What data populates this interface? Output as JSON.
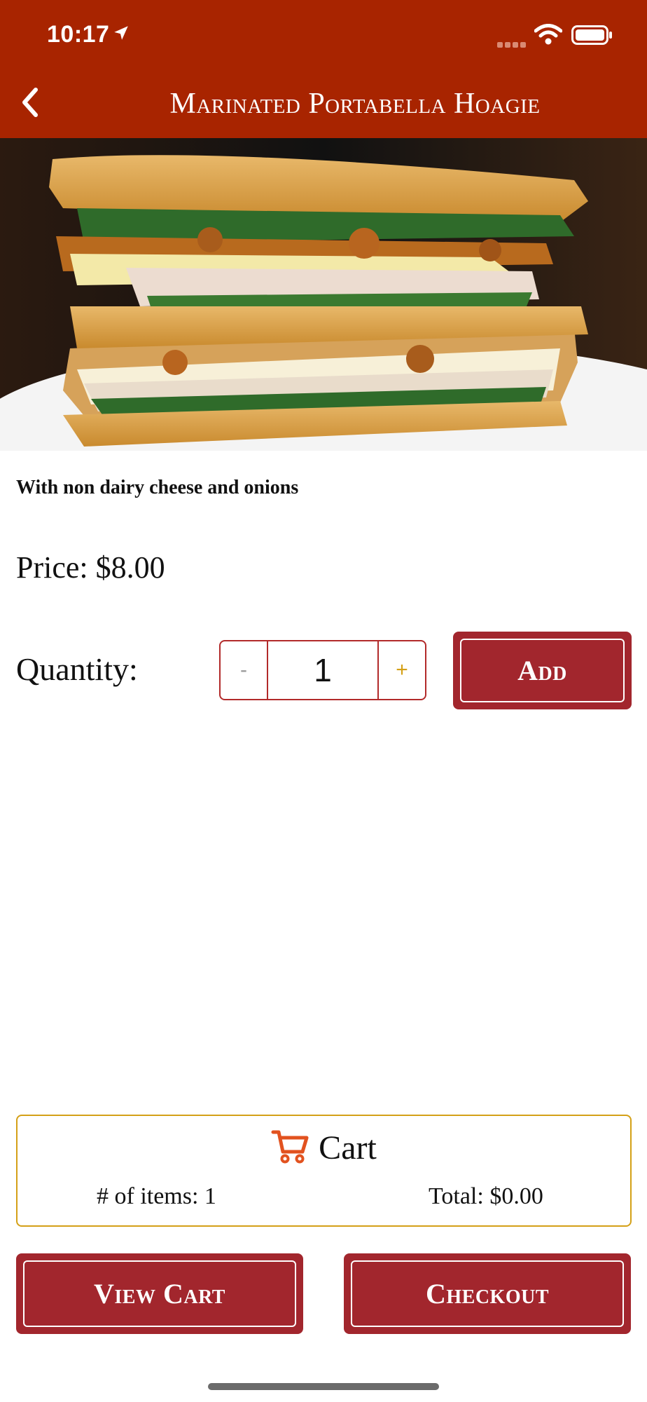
{
  "status_bar": {
    "time": "10:17",
    "icons": [
      "location-arrow-icon",
      "cellular-signal-icon",
      "wifi-icon",
      "battery-icon"
    ]
  },
  "header": {
    "title": "Marinated Portabella Hoagie",
    "back_icon": "chevron-left-icon",
    "background": "#a82400"
  },
  "product": {
    "image_subject": "sandwich",
    "description": "With non dairy cheese and onions",
    "price_text": "Price: $8.00"
  },
  "quantity": {
    "label": "Quantity:",
    "decrement": "-",
    "value": "1",
    "increment": "+"
  },
  "buttons": {
    "add": "Add",
    "view_cart": "View Cart",
    "checkout": "Checkout"
  },
  "cart": {
    "icon": "shopping-cart-icon",
    "title": "Cart",
    "items_text": "# of items: 1",
    "total_text": "Total: $0.00"
  },
  "colors": {
    "brand_red": "#a2262d",
    "header_red": "#a82400",
    "accent_gold": "#d4a017",
    "cart_icon_orange": "#e2521f"
  }
}
